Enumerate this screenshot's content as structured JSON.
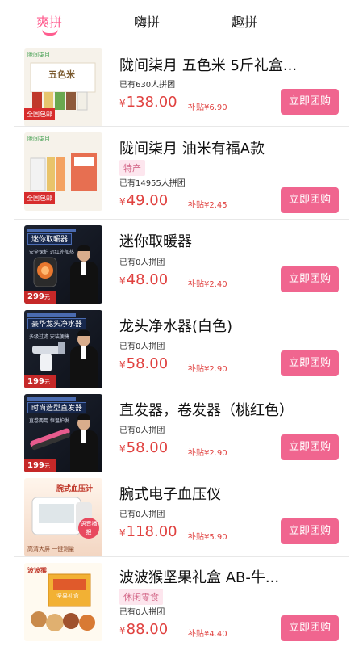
{
  "tabs": [
    {
      "label": "爽拼",
      "active": true
    },
    {
      "label": "嗨拼",
      "active": false
    },
    {
      "label": "趣拼",
      "active": false
    }
  ],
  "buy_label": "立即团购",
  "subsidy_prefix": "补贴",
  "currency": "¥",
  "products": [
    {
      "title": "陇间柒月 五色米 5斤礼盒...",
      "tag": "",
      "joined": "已有630人拼团",
      "price": "138.00",
      "subsidy": "¥6.90",
      "thumb": {
        "style": "rice",
        "brand": "陇间柒月",
        "text": "五色米",
        "badge": "全国包邮"
      }
    },
    {
      "title": "陇间柒月 油米有福A款",
      "tag": "特产",
      "joined": "已有14955人拼团",
      "price": "49.00",
      "subsidy": "¥2.45",
      "thumb": {
        "style": "oil",
        "brand": "陇间柒月",
        "text": "",
        "badge": "全国包邮"
      }
    },
    {
      "title": "迷你取暖器",
      "tag": "",
      "joined": "已有0人拼团",
      "price": "48.00",
      "subsidy": "¥2.40",
      "thumb": {
        "style": "heater",
        "text": "迷你取暖器",
        "sub": "安全保护 远红外加热",
        "price_tag": "299",
        "price_unit": "元"
      }
    },
    {
      "title": "龙头净水器(白色)",
      "tag": "",
      "joined": "已有0人拼团",
      "price": "58.00",
      "subsidy": "¥2.90",
      "thumb": {
        "style": "filter",
        "text": "豪华龙头净水器",
        "sub": "多级过滤 安装便捷",
        "price_tag": "199",
        "price_unit": "元"
      }
    },
    {
      "title": "直发器，卷发器（桃红色）",
      "tag": "",
      "joined": "已有0人拼团",
      "price": "58.00",
      "subsidy": "¥2.90",
      "thumb": {
        "style": "straightener",
        "text": "时尚造型直发器",
        "sub": "直卷两用 恒温护发",
        "price_tag": "199",
        "price_unit": "元"
      }
    },
    {
      "title": "腕式电子血压仪",
      "tag": "",
      "joined": "已有0人拼团",
      "price": "118.00",
      "subsidy": "¥5.90",
      "thumb": {
        "style": "monitor",
        "text": "腕式血压计",
        "sub": "高清大屏 一键测量",
        "badge": "语音播报"
      }
    },
    {
      "title": "波波猴坚果礼盒 AB-牛...",
      "tag": "休闲零食",
      "joined": "已有0人拼团",
      "price": "88.00",
      "subsidy": "¥4.40",
      "thumb": {
        "style": "nuts",
        "brand": "波波猴",
        "text": "坚果礼盒"
      }
    }
  ],
  "colors": {
    "accent": "#f0658f",
    "price": "#e0413f",
    "tag_bg": "#fde6ee"
  }
}
